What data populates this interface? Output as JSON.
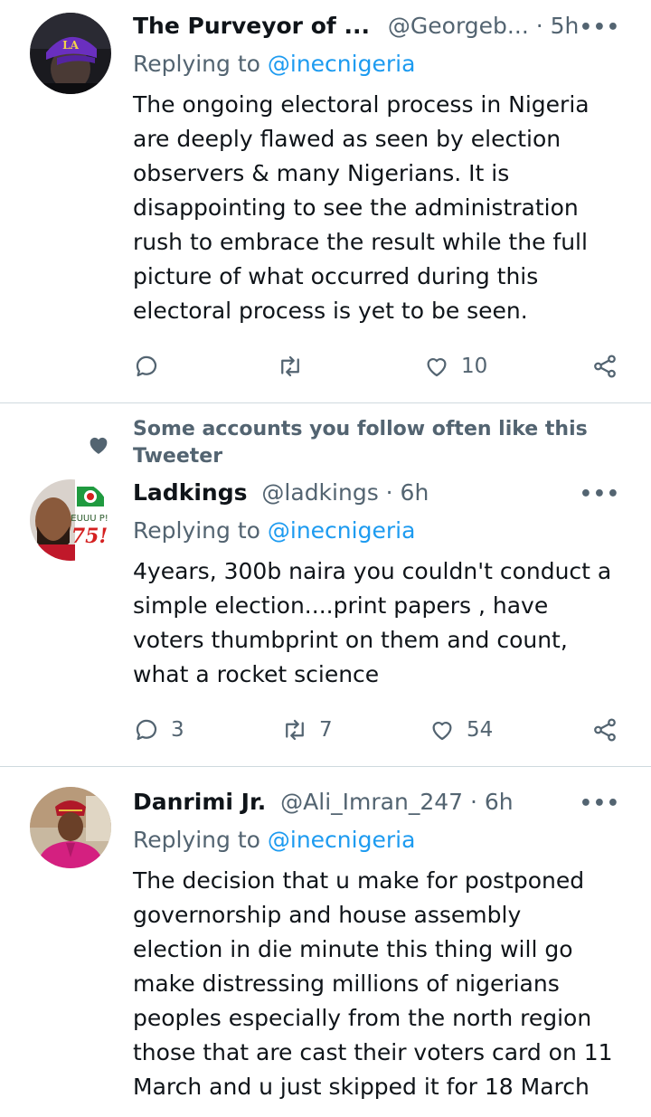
{
  "tweets": [
    {
      "name": "The Purveyor of ...",
      "handle": "@Georgeb... · 5h",
      "replying_prefix": "Replying to ",
      "replying_to": "@inecnigeria",
      "body_lines": [
        "The ongoing electoral process in Nigeria",
        "are deeply flawed as seen by election",
        "observers & many Nigerians. It is",
        "disappointing to see the administration",
        "rush to embrace the result while the full",
        "picture of what occurred during this",
        "electoral process is yet to be seen."
      ],
      "replies": "",
      "retweets": "",
      "likes": "10"
    },
    {
      "social_context": "Some accounts you follow often like this Tweeter",
      "name": "Ladkings",
      "handle": "@ladkings · 6h",
      "replying_prefix": "Replying to ",
      "replying_to": "@inecnigeria",
      "avatar_text_1": "EUUU P!",
      "avatar_text_2": "75!",
      "body_lines": [
        "4years, 300b naira you couldn't conduct a",
        "simple election....print papers , have",
        "voters thumbprint on them and count,",
        "what a rocket science"
      ],
      "replies": "3",
      "retweets": "7",
      "likes": "54"
    },
    {
      "name": "Danrimi Jr.",
      "handle": "@Ali_Imran_247 · 6h",
      "replying_prefix": "Replying to ",
      "replying_to": "@inecnigeria",
      "body_lines": [
        "The decision that u make for  postponed",
        "governorship and house assembly",
        "election in die minute this thing will go",
        "make distressing millions of nigerians",
        "peoples especially from the north region",
        "those that are cast their voters card on 11",
        "March and u just skipped it for 18 March"
      ]
    }
  ],
  "more_glyph": "•••",
  "icons": {
    "reply": "reply-icon",
    "retweet": "retweet-icon",
    "like": "heart-icon",
    "share": "share-icon"
  },
  "colors": {
    "text": "#0f1419",
    "secondary": "#536471",
    "accent": "#1d9bf0",
    "divider": "#cfd9de"
  }
}
